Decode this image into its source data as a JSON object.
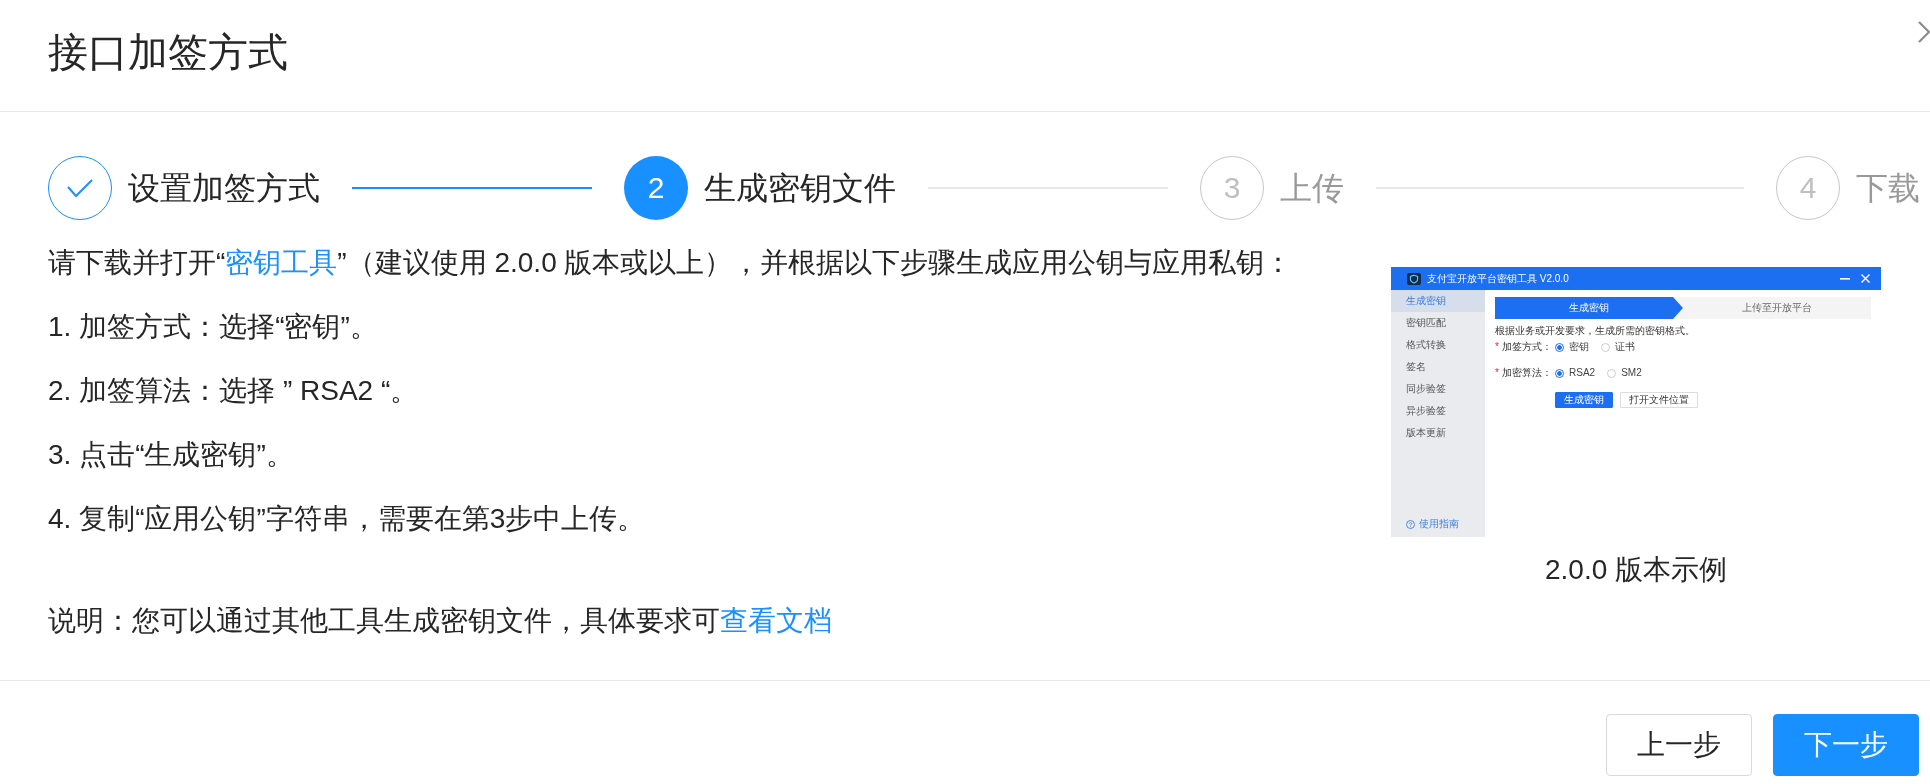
{
  "dialog": {
    "title": "接口加签方式"
  },
  "steps": [
    {
      "kind": "done",
      "title": "设置加签方式"
    },
    {
      "kind": "current",
      "number": "2",
      "title": "生成密钥文件"
    },
    {
      "kind": "pending",
      "number": "3",
      "title": "上传"
    },
    {
      "kind": "pending",
      "number": "4",
      "title": "下载"
    }
  ],
  "instructions": {
    "intro": {
      "before": "请下载并打开“",
      "link": "密钥工具",
      "after": "”（建议使用 2.0.0 版本或以上），并根据以下步骤生成应用公钥与应用私钥："
    },
    "items": [
      "1. 加签方式：选择“密钥”。",
      "2. 加签算法：选择 ” RSA2 “。",
      "3. 点击“生成密钥”。",
      "4. 复制“应用公钥”字符串，需要在第3步中上传。"
    ],
    "note": {
      "text": "说明：您可以通过其他工具生成密钥文件，具体要求可",
      "link": "查看文档"
    }
  },
  "example": {
    "window": {
      "title": "支付宝开放平台密钥工具 V2.0.0",
      "menu": [
        {
          "label": "生成密钥",
          "selected": true
        },
        {
          "label": "密钥匹配",
          "selected": false
        },
        {
          "label": "格式转换",
          "selected": false
        },
        {
          "label": "签名",
          "selected": false
        },
        {
          "label": "同步验签",
          "selected": false
        },
        {
          "label": "异步验签",
          "selected": false
        },
        {
          "label": "版本更新",
          "selected": false
        }
      ],
      "help": "使用指南",
      "tabs": [
        {
          "label": "生成密钥",
          "selected": true
        },
        {
          "label": "上传至开放平台",
          "selected": false
        }
      ],
      "description": "根据业务或开发要求，生成所需的密钥格式。",
      "fields": [
        {
          "mark": "*",
          "label": "加签方式：",
          "options": [
            {
              "label": "密钥",
              "selected": true
            },
            {
              "label": "证书",
              "selected": false
            }
          ]
        },
        {
          "mark": "*",
          "label": "加密算法：",
          "options": [
            {
              "label": "RSA2",
              "selected": true
            },
            {
              "label": "SM2",
              "selected": false
            }
          ]
        }
      ],
      "buttons": [
        {
          "label": "生成密钥",
          "kind": "primary"
        },
        {
          "label": "打开文件位置",
          "kind": "default"
        }
      ]
    },
    "caption": "2.0.0 版本示例"
  },
  "footer": {
    "buttons": [
      {
        "label": "上一步",
        "kind": "default"
      },
      {
        "label": "下一步",
        "kind": "primary"
      }
    ]
  }
}
